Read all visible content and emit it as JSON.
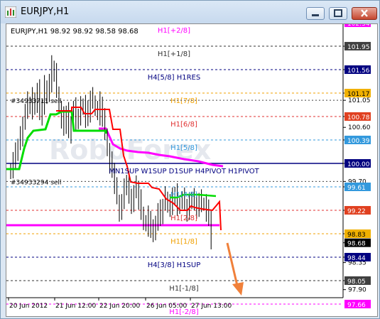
{
  "window": {
    "title": "EURJPY,H1"
  },
  "chart_header": "EURJPY,H1  98.92 98.92 98.58 98.68",
  "watermark": "RoboForex",
  "colors": {
    "candle": "#000000",
    "green_line": "#00dd00",
    "red_line": "#ff0000",
    "magenta_line": "#ff00ff",
    "navy_line": "#000080",
    "arrow": "#f0803a"
  },
  "price_axis": {
    "ticks": [
      "101.95",
      "101.56",
      "101.17",
      "101.05",
      "100.78",
      "100.60",
      "100.39",
      "100.00",
      "99.70",
      "99.61",
      "99.22",
      "98.83",
      "98.68",
      "98.44",
      "98.35",
      "98.05",
      "97.90",
      "97.66",
      "97.45"
    ]
  },
  "time_axis": {
    "labels": [
      "20 Jun 2012",
      "21 Jun 12:00",
      "22 Jun 20:00",
      "26 Jun 05:00",
      "27 Jun 13:00"
    ]
  },
  "levels": [
    {
      "label": "H1[+2/8]",
      "price": 102.34,
      "color": "#ff00ff",
      "tag": "102.34",
      "tagColor": "#ff00ff"
    },
    {
      "label": "H1[+1/8]",
      "price": 101.95,
      "color": "#333333",
      "tag": "101.95",
      "tagColor": "#404040"
    },
    {
      "label": "H4[5/8] H1RES",
      "price": 101.56,
      "color": "#000080",
      "tag": "101.56",
      "tagColor": "#000080"
    },
    {
      "label": "H1[7/8]",
      "price": 101.17,
      "color": "#f0a000",
      "tag": "101.17",
      "tagColor": "#f0b000"
    },
    {
      "label": "H1[6/8]",
      "price": 100.78,
      "color": "#e03030",
      "tag": "100.78",
      "tagColor": "#e04020"
    },
    {
      "label": "H1[5/8]",
      "price": 100.39,
      "color": "#3399dd",
      "tag": "100.39",
      "tagColor": "#3399dd"
    },
    {
      "label": "MN1SUP W1SUP D1SUP H4PIVOT H1PIVOT",
      "price": 100.0,
      "color": "#000080",
      "tag": "100.00",
      "tagColor": "#000080"
    },
    {
      "label": "H1[4/8]",
      "price": 99.61,
      "color": "#3399dd",
      "tag": "99.61",
      "tagColor": "#3399dd"
    },
    {
      "label": "H1[2/8]",
      "price": 99.22,
      "color": "#e03030",
      "tag": "99.22",
      "tagColor": "#e04020"
    },
    {
      "label": "H1[1/8]",
      "price": 98.83,
      "color": "#f0a000",
      "tag": "98.83",
      "tagColor": "#f0b000"
    },
    {
      "label": "H4[3/8] H1SUP",
      "price": 98.44,
      "color": "#000080",
      "tag": "98.44",
      "tagColor": "#000080"
    },
    {
      "label": "H1[-1/8]",
      "price": 98.05,
      "color": "#333333",
      "tag": "98.05",
      "tagColor": "#404040"
    },
    {
      "label": "H1[-2/8]",
      "price": 97.66,
      "color": "#ff00ff",
      "tag": "97.66",
      "tagColor": "#ff00ff"
    }
  ],
  "current_price_tag": "98.68",
  "orders": [
    {
      "label": "#34933711 sell",
      "price": 101.05
    },
    {
      "label": "#34933294 sell",
      "price": 99.7
    }
  ]
}
